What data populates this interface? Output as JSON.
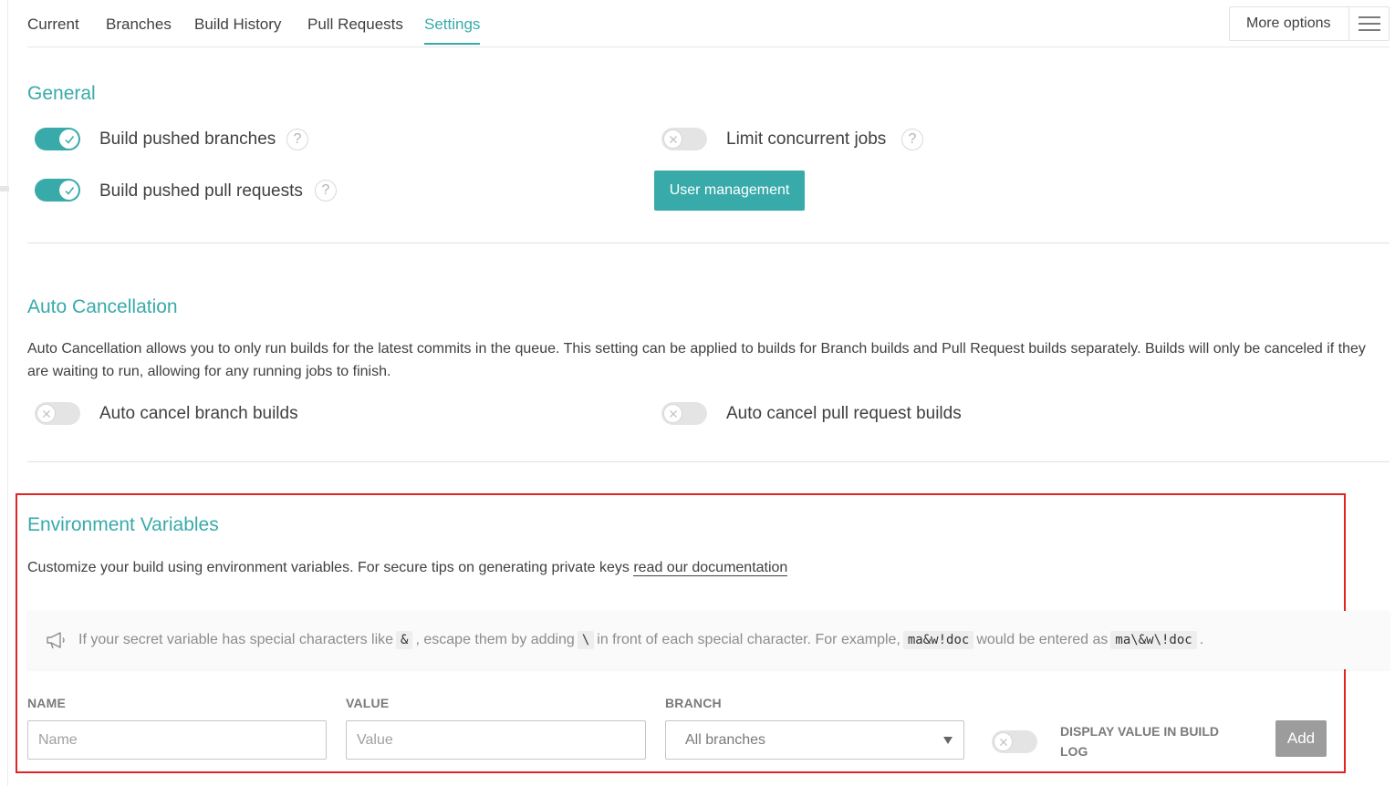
{
  "tabs": [
    {
      "label": "Current"
    },
    {
      "label": "Branches"
    },
    {
      "label": "Build History"
    },
    {
      "label": "Pull Requests"
    },
    {
      "label": "Settings",
      "active": true
    }
  ],
  "more_options": {
    "label": "More options",
    "icon": "hamburger-menu-icon"
  },
  "general": {
    "title": "General",
    "build_pushed_branches": {
      "label": "Build pushed branches",
      "enabled": true,
      "help": "?"
    },
    "build_pushed_pull_requests": {
      "label": "Build pushed pull requests",
      "enabled": true,
      "help": "?"
    },
    "limit_concurrent_jobs": {
      "label": "Limit concurrent jobs",
      "enabled": false,
      "help": "?"
    },
    "user_management_button": "User management"
  },
  "auto_cancellation": {
    "title": "Auto Cancellation",
    "description": "Auto Cancellation allows you to only run builds for the latest commits in the queue. This setting can be applied to builds for Branch builds and Pull Request builds separately. Builds will only be canceled if they are waiting to run, allowing for any running jobs to finish.",
    "branch_builds": {
      "label": "Auto cancel branch builds",
      "enabled": false
    },
    "pull_request_builds": {
      "label": "Auto cancel pull request builds",
      "enabled": false
    }
  },
  "environment_variables": {
    "title": "Environment Variables",
    "description": "Customize your build using environment variables. For secure tips on generating private keys ",
    "doc_link": "read our documentation",
    "notice": {
      "icon": "megaphone-icon",
      "part1": "If your secret variable has special characters like",
      "code1": "&",
      "part2": ", escape them by adding",
      "code2": "\\",
      "part3": "in front of each special character. For example,",
      "code3": "ma&w!doc",
      "part4": "would be entered as",
      "code4": "ma\\&w\\!doc",
      "part5": "."
    },
    "name_label": "NAME",
    "name_placeholder": "Name",
    "value_label": "VALUE",
    "value_placeholder": "Value",
    "branch_label": "BRANCH",
    "branch_selected": "All branches",
    "display_value": {
      "label": "DISPLAY VALUE IN BUILD LOG",
      "enabled": false
    },
    "add_button": "Add"
  },
  "colors": {
    "accent": "#39aaaa",
    "highlight_border": "#e02424",
    "add_button": "#9c9c9c"
  }
}
